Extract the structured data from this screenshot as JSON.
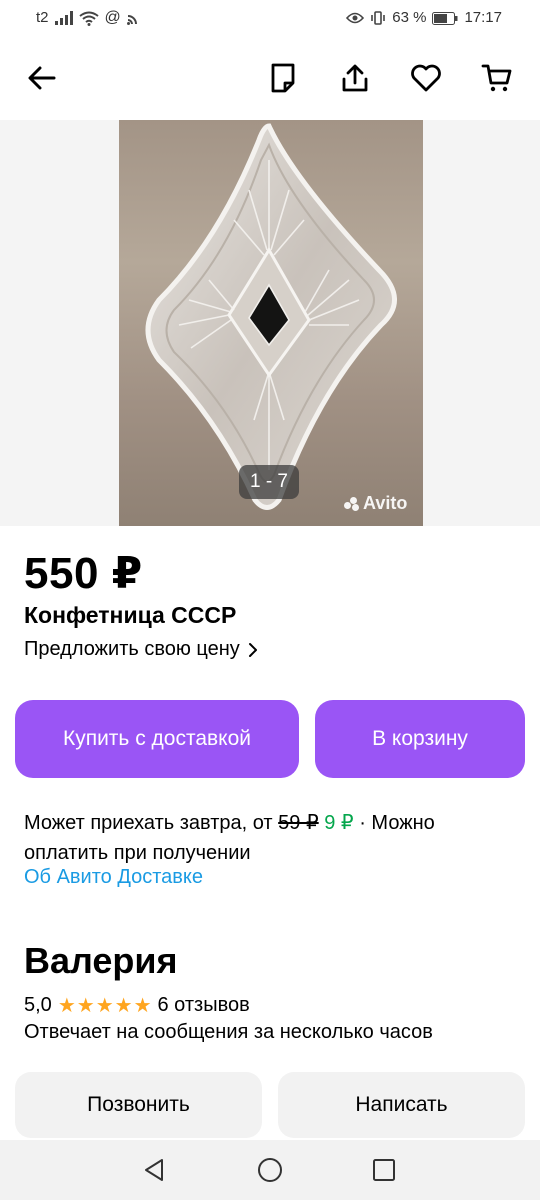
{
  "status_bar": {
    "carrier": "t2",
    "battery_percent": "63 %",
    "time": "17:17"
  },
  "gallery": {
    "counter": "1 - 7",
    "watermark": "Avito"
  },
  "listing": {
    "price": "550 ₽",
    "title": "Конфетница СССР",
    "offer_price_label": "Предложить свою цену"
  },
  "actions": {
    "buy_with_delivery": "Купить с доставкой",
    "add_to_cart": "В корзину"
  },
  "delivery": {
    "text_prefix": "Может приехать завтра, от",
    "old_price": "59 ₽",
    "new_price": "9 ₽",
    "text_suffix": "· Можно оплатить при получении",
    "link": "Об Авито Доставке"
  },
  "seller": {
    "name": "Валерия",
    "rating": "5,0",
    "stars": 5,
    "reviews": "6 отзывов",
    "reply_note": "Отвечает на сообщения за несколько часов"
  },
  "contact": {
    "call": "Позвонить",
    "message": "Написать"
  },
  "colors": {
    "primary": "#9a55f5",
    "link": "#1a9be3",
    "discount": "#04a64c",
    "star": "#ffa51f"
  },
  "icons": [
    "back-arrow-icon",
    "note-icon",
    "share-icon",
    "heart-icon",
    "cart-icon",
    "star-icon",
    "nav-back-icon",
    "nav-home-icon",
    "nav-recents-icon"
  ]
}
